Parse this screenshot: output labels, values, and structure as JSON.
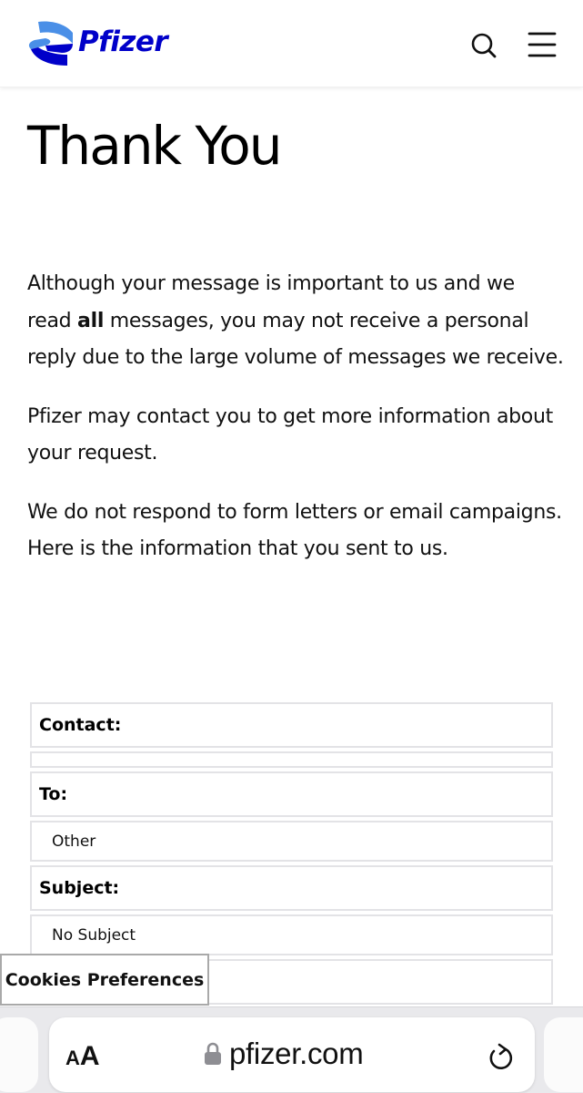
{
  "header": {
    "brand": "Pfizer",
    "brand_colors": {
      "dark": "#0000c9",
      "light": "#4a8fe7"
    },
    "icons": [
      "search-icon",
      "hamburger-menu-icon"
    ]
  },
  "page": {
    "title": "Thank You",
    "paragraph1": {
      "before": "Although your message is important to us and we read ",
      "bold": "all",
      "after": " messages, you may not receive a personal reply due to the large volume of messages we receive."
    },
    "paragraph2": "Pfizer may contact you to get more information about your request.",
    "paragraph3": "We do not respond to form letters or email campaigns. Here is the information that you sent to us."
  },
  "info_table": {
    "contact_label": "Contact:",
    "contact_value": "",
    "to_label": "To:",
    "to_value": "Other",
    "subject_label": "Subject:",
    "subject_value": "No Subject"
  },
  "cookies": {
    "label": "Cookies Preferences"
  },
  "browser": {
    "text_size_small": "A",
    "text_size_big": "A",
    "url": "pfizer.com",
    "icons": [
      "lock-icon",
      "reload-icon"
    ]
  }
}
